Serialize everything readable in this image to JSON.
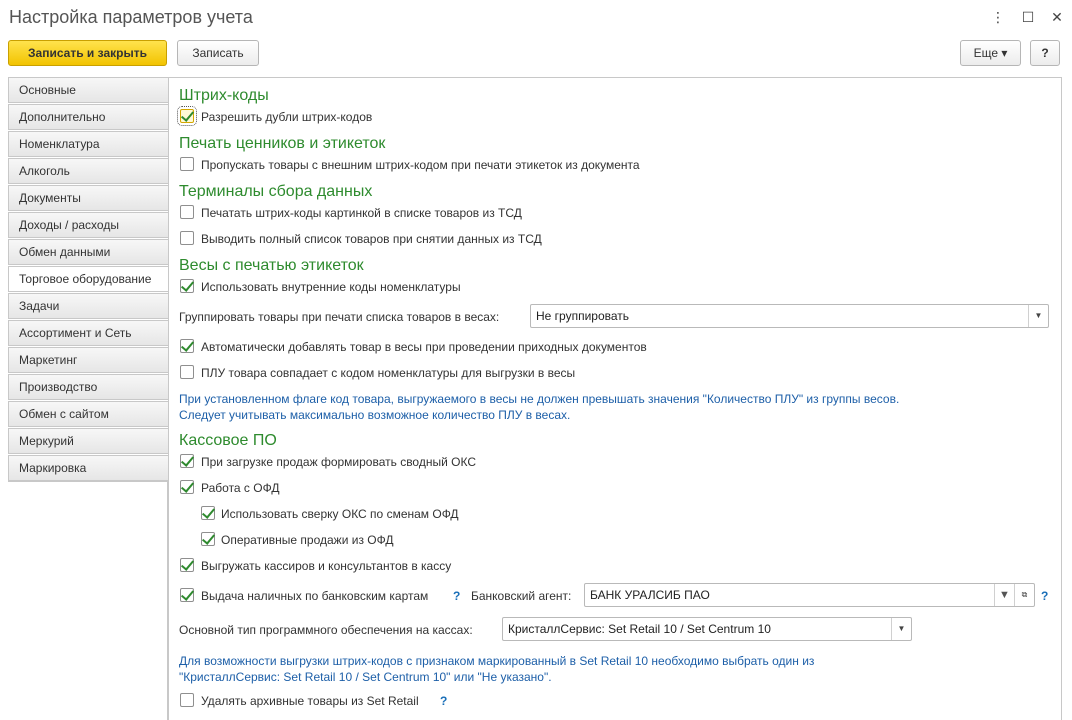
{
  "window": {
    "title": "Настройка параметров учета",
    "menu_icon": "⋮",
    "maximize_icon": "☐",
    "close_icon": "✕"
  },
  "toolbar": {
    "save_close": "Записать и закрыть",
    "save": "Записать",
    "more": "Еще ▾",
    "help": "?"
  },
  "sidebar": {
    "items": [
      "Основные",
      "Дополнительно",
      "Номенклатура",
      "Алкоголь",
      "Документы",
      "Доходы / расходы",
      "Обмен данными",
      "Торговое оборудование",
      "Задачи",
      "Ассортимент и Сеть",
      "Маркетинг",
      "Производство",
      "Обмен с сайтом",
      "Меркурий",
      "Маркировка"
    ],
    "active": "Торговое оборудование"
  },
  "barcodes": {
    "title": "Штрих-коды",
    "allow_duplicates": "Разрешить дубли штрих-кодов"
  },
  "labels": {
    "title": "Печать ценников и этикеток",
    "skip_external": "Пропускать товары с внешним штрих-кодом при печати этикеток из документа"
  },
  "tsd": {
    "title": "Терминалы сбора данных",
    "print_barcodes": "Печатать штрих-коды картинкой в списке товаров из ТСД",
    "full_list": "Выводить полный список товаров при снятии данных из ТСД"
  },
  "scales": {
    "title": "Весы с печатью этикеток",
    "internal_codes": "Использовать внутренние коды номенклатуры",
    "group_label": "Группировать товары при печати списка товаров в весах:",
    "group_value": "Не группировать",
    "auto_add": "Автоматически добавлять товар в весы при проведении приходных документов",
    "plu_match": "ПЛУ товара совпадает с кодом номенклатуры для выгрузки в весы",
    "note_line1": "При установленном флаге код товара, выгружаемого в весы не должен превышать значения \"Количество ПЛУ\" из группы весов.",
    "note_line2": "Следует учитывать максимально возможное количество ПЛУ в весах."
  },
  "pos": {
    "title": "Кассовое ПО",
    "summary_oks": "При загрузке продаж формировать сводный ОКС",
    "ofd": "Работа с ОФД",
    "oks_reconcile": "Использовать сверку ОКС по сменам ОФД",
    "ofd_sales": "Оперативные продажи из ОФД",
    "export_cashiers": "Выгружать кассиров и консультантов в кассу",
    "cash_out": "Выдача наличных по банковским картам",
    "help_mark": "?",
    "bank_agent_label": "Банковский агент:",
    "bank_agent_value": "БАНК УРАЛСИБ ПАО",
    "software_label": "Основной тип программного обеспечения на кассах:",
    "software_value": "КристаллСервис: Set Retail 10 / Set Centrum 10",
    "note_line1": "Для возможности выгрузки штрих-кодов с признаком маркированный в Set Retail 10 необходимо выбрать один из",
    "note_line2": "\"КристаллСервис: Set Retail 10 / Set Centrum 10\" или \"Не указано\".",
    "delete_archive": "Удалять архивные товары из Set Retail"
  }
}
